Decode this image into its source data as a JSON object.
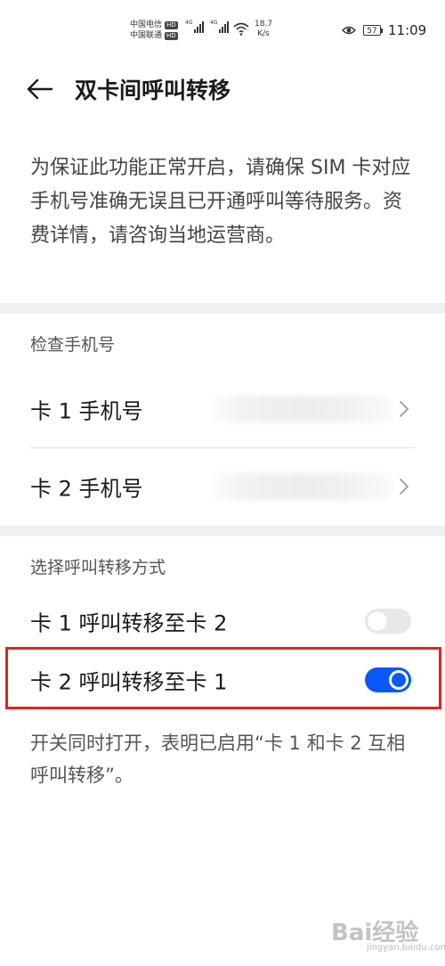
{
  "status_bar": {
    "carrier1": "中国电信",
    "carrier2": "中国联通",
    "hd": "HD",
    "net1": "4G",
    "net2": "4G",
    "speed_value": "18.7",
    "speed_unit": "K/s",
    "battery": "57",
    "time": "11:09"
  },
  "header": {
    "title": "双卡间呼叫转移"
  },
  "intro_text": "为保证此功能正常开启，请确保 SIM 卡对应手机号准确无误且已开通呼叫等待服务。资费详情，请咨询当地运营商。",
  "check_section": {
    "heading": "检查手机号",
    "items": [
      {
        "label": "卡 1 手机号"
      },
      {
        "label": "卡 2 手机号"
      }
    ]
  },
  "forward_section": {
    "heading": "选择呼叫转移方式",
    "items": [
      {
        "label": "卡 1 呼叫转移至卡 2",
        "enabled": false
      },
      {
        "label": "卡 2 呼叫转移至卡 1",
        "enabled": true
      }
    ]
  },
  "footnote": "开关同时打开，表明已启用“卡 1 和卡 2 互相呼叫转移”。",
  "watermark": {
    "text": "Bai经验",
    "sub": "jingyan.baidu.com"
  },
  "colors": {
    "accent": "#0a59f7",
    "highlight": "#e2231a"
  }
}
